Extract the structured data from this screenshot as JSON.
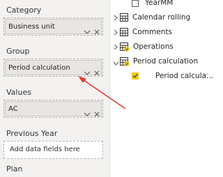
{
  "wells": {
    "category": {
      "label": "Category",
      "field": "Business unit"
    },
    "group": {
      "label": "Group",
      "field": "Period calculation"
    },
    "values": {
      "label": "Values",
      "field": "AC"
    },
    "previous_year": {
      "label": "Previous Year",
      "placeholder": "Add data fields here"
    },
    "plan": {
      "label": "Plan"
    }
  },
  "fields_tree": {
    "items": [
      {
        "label": "YearMM",
        "type": "field",
        "checked": false
      },
      {
        "label": "Calendar rolling",
        "type": "table",
        "expanded": false
      },
      {
        "label": "Comments",
        "type": "table",
        "expanded": false
      },
      {
        "label": "Operations",
        "type": "table",
        "expanded": false,
        "in_use": true
      },
      {
        "label": "Period calculation",
        "type": "table",
        "expanded": true,
        "in_use": true
      },
      {
        "label": "Period calcula...",
        "type": "field",
        "checked": true
      }
    ],
    "more_label": "···"
  },
  "colors": {
    "accent_yellow": "#f2c811",
    "arrow_red": "#e03c31",
    "well_background": "#f3f2f1"
  }
}
